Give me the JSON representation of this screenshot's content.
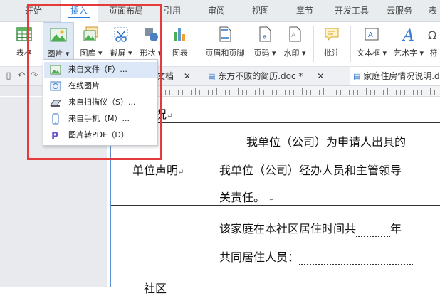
{
  "tabs": [
    "开始",
    "插入",
    "页面布局",
    "引用",
    "审阅",
    "视图",
    "章节",
    "开发工具",
    "云服务",
    "表"
  ],
  "active_tab": "插入",
  "ribbon": {
    "table": "表格",
    "picture": "图片",
    "gallery": "图库",
    "screenshot": "截屏",
    "shape": "形状",
    "chart": "图表",
    "header_footer": "页眉和页脚",
    "page_number": "页码",
    "watermark": "水印",
    "comment": "批注",
    "textbox": "文本框",
    "wordart": "艺术字",
    "symbol": "符"
  },
  "picture_menu": {
    "items": [
      "来自文件（F）...",
      "在线图片",
      "来自扫描仪（S）...",
      "来自手机（M）...",
      "图片转PDF（D）"
    ]
  },
  "doc_tabs": {
    "tab1": "文档",
    "tab2": "东方不败的简历.doc *",
    "tab3": "家庭住房情况说明.d"
  },
  "document": {
    "heading_fragment": "情况",
    "row1_label": "单位声明",
    "row1_line1": "我单位（公司）为申请人出具的",
    "row1_line2": "我单位（公司）经办人员和主管领导",
    "row1_line3": "关责任。",
    "row2_line1": "该家庭在本社区居住时间共",
    "row2_line1_end": "年",
    "row2_line2": "共同居住人员：",
    "row2_label_fragment": "社区"
  },
  "colors": {
    "accent": "#2a7bd6",
    "highlight_box": "#e5393c",
    "margin_line": "#5a8fd0"
  }
}
